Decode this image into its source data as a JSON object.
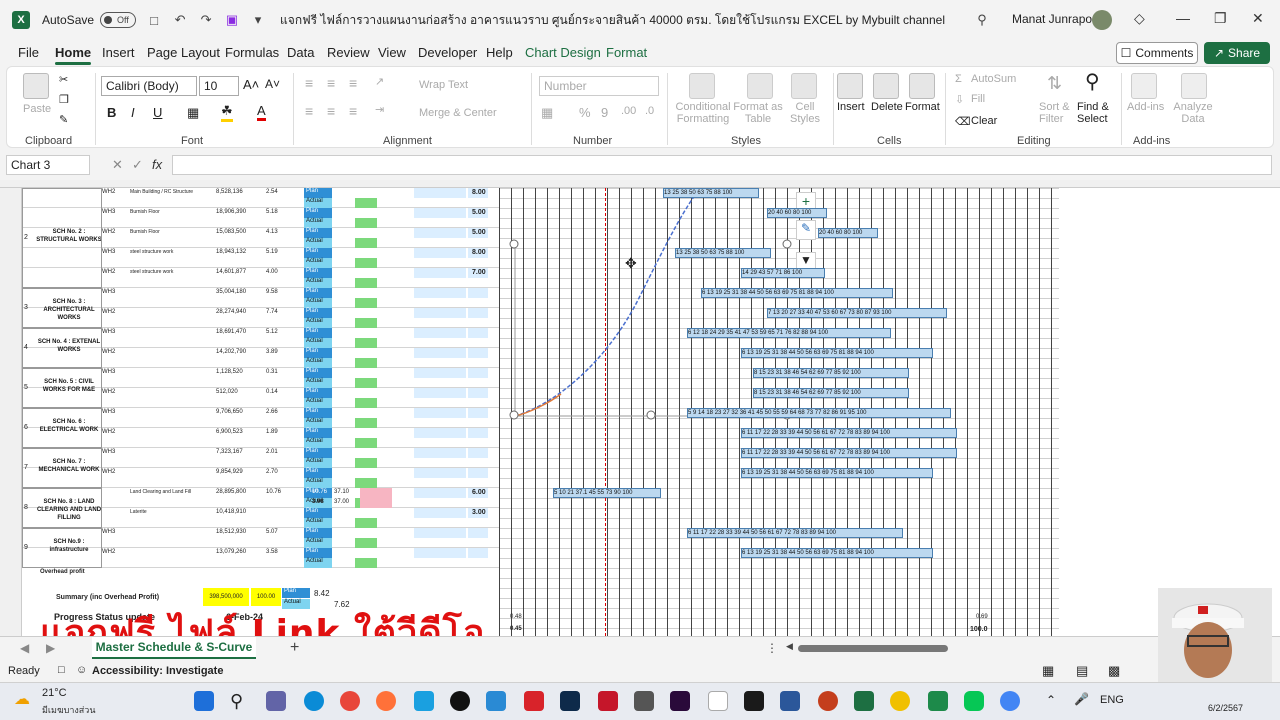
{
  "titlebar": {
    "app_icon": "X",
    "autosave_label": "AutoSave",
    "autosave_state": "Off",
    "doc_title": "แจกฟรี ไฟล์การวางแผนงานก่อสร้าง อาคารแนวราบ ศูนย์กระจายสินค้า 40000 ตรม. โดยใช้โปรแกรม EXCEL by Mybuilt channel",
    "user": "Manat Junrapoo",
    "icons": [
      "save-icon",
      "undo-icon",
      "redo-icon",
      "search-icon",
      "diamond-icon",
      "minimize-icon",
      "restore-icon",
      "close-icon"
    ]
  },
  "menu": {
    "tabs": [
      "File",
      "Home",
      "Insert",
      "Page Layout",
      "Formulas",
      "Data",
      "Review",
      "View",
      "Developer",
      "Help",
      "Chart Design",
      "Format"
    ],
    "comments": "Comments",
    "share": "Share"
  },
  "ribbon": {
    "clipboard": {
      "paste": "Paste",
      "label": "Clipboard"
    },
    "font": {
      "name": "Calibri (Body)",
      "size": "10",
      "bold": "B",
      "italic": "I",
      "underline": "U",
      "label": "Font"
    },
    "alignment": {
      "wrap": "Wrap Text",
      "merge": "Merge & Center",
      "label": "Alignment"
    },
    "number": {
      "format": "Number",
      "label": "Number"
    },
    "styles": {
      "conditional": "Conditional Formatting",
      "format_table": "Format as Table",
      "cell_styles": "Cell Styles",
      "label": "Styles"
    },
    "cells": {
      "insert": "Insert",
      "delete": "Delete",
      "format": "Format",
      "label": "Cells"
    },
    "editing": {
      "autosum": "AutoSum",
      "fill": "Fill",
      "clear": "Clear",
      "sort": "Sort & Filter",
      "find": "Find & Select",
      "label": "Editing"
    },
    "addins": {
      "addins": "Add-ins",
      "analyze": "Analyze Data",
      "label": "Add-ins"
    }
  },
  "formula_bar": {
    "name_box": "Chart 3",
    "fx": "fx",
    "content": ""
  },
  "sheet": {
    "rows": [
      {
        "no": "2",
        "sch": "SCH No. 2 : STRUCTURAL WORKS",
        "items": [
          {
            "zone": "WH2",
            "desc": "Main Building / RC Structure",
            "amount": "8,528,136",
            "pct": "2.54",
            "pv": "8.00"
          },
          {
            "zone": "WH3",
            "desc": "Burnish Floor",
            "amount": "18,906,390",
            "pct": "5.18",
            "pv": "5.00"
          },
          {
            "zone": "WH2",
            "desc": "Burnish Floor",
            "amount": "15,083,500",
            "pct": "4.13",
            "pv": "5.00"
          },
          {
            "zone": "WH3",
            "desc": "steel structure work",
            "amount": "18,943,132",
            "pct": "5.19",
            "pv": "8.00"
          },
          {
            "zone": "WH2",
            "desc": "steel structure work",
            "amount": "14,601,877",
            "pct": "4.00",
            "pv": "7.00"
          }
        ]
      },
      {
        "no": "3",
        "sch": "SCH No. 3 : ARCHITECTURAL WORKS",
        "items": [
          {
            "zone": "WH3",
            "desc": "",
            "amount": "35,004,180",
            "pct": "9.58",
            "pv": ""
          },
          {
            "zone": "WH2",
            "desc": "",
            "amount": "28,274,940",
            "pct": "7.74",
            "pv": ""
          }
        ]
      },
      {
        "no": "4",
        "sch": "SCH No. 4 : EXTENAL WORKS",
        "items": [
          {
            "zone": "WH3",
            "desc": "",
            "amount": "18,691,470",
            "pct": "5.12",
            "pv": ""
          },
          {
            "zone": "WH2",
            "desc": "",
            "amount": "14,202,790",
            "pct": "3.89",
            "pv": ""
          }
        ]
      },
      {
        "no": "5",
        "sch": "SCH No. 5 : CIVIL WORKS FOR M&E",
        "items": [
          {
            "zone": "WH3",
            "desc": "",
            "amount": "1,128,520",
            "pct": "0.31",
            "pv": ""
          },
          {
            "zone": "WH2",
            "desc": "",
            "amount": "512,020",
            "pct": "0.14",
            "pv": ""
          }
        ]
      },
      {
        "no": "6",
        "sch": "SCH No. 6 : ELECTRICAL WORK",
        "items": [
          {
            "zone": "WH3",
            "desc": "",
            "amount": "9,706,650",
            "pct": "2.66",
            "pv": ""
          },
          {
            "zone": "WH2",
            "desc": "",
            "amount": "6,900,523",
            "pct": "1.89",
            "pv": ""
          }
        ]
      },
      {
        "no": "7",
        "sch": "SCH No. 7 : MECHANICAL WORK",
        "items": [
          {
            "zone": "WH3",
            "desc": "",
            "amount": "7,323,167",
            "pct": "2.01",
            "pv": ""
          },
          {
            "zone": "WH2",
            "desc": "",
            "amount": "9,854,929",
            "pct": "2.70",
            "pv": ""
          }
        ]
      },
      {
        "no": "8",
        "sch": "SCH No. 8 : LAND CLEARING AND LAND FILLING",
        "items": [
          {
            "zone": "",
            "desc": "Land Clearing and Land Fill",
            "amount": "28,895,800",
            "pct": "10.76",
            "pv": "6.00"
          },
          {
            "zone": "",
            "desc": "Laterite",
            "amount": "10,418,910",
            "pct": "",
            "pv": "3.00"
          }
        ]
      },
      {
        "no": "9",
        "sch": "SCH No.9 : infrastructure",
        "items": [
          {
            "zone": "WH3",
            "desc": "",
            "amount": "18,512,930",
            "pct": "5.07",
            "pv": ""
          },
          {
            "zone": "WH2",
            "desc": "",
            "amount": "13,079,260",
            "pct": "3.58",
            "pv": ""
          }
        ]
      }
    ],
    "overhead": "Overhead profit",
    "summary_label": "Summary (inc Overhead Profit)",
    "summary_total": "398,500,000",
    "summary_pct": "100.00",
    "summary_plan": "8.42",
    "summary_actual": "7.62",
    "plan_label": "Plan",
    "actual_label": "Actual",
    "progress_label": "Progress Status update",
    "progress_date": "6-Feb-24",
    "row8_plan_val": "10.76",
    "row8_plan_val2": "37.10",
    "row8_actual_val": "3.98",
    "row8_actual_val2": "37.00",
    "final_pct": "100.0",
    "plan_cum": "0.48",
    "actual_cum": "0.45",
    "final_pct2": "0.69"
  },
  "gantt_bars": [
    {
      "row": "r1",
      "values": "13 25 38 50 63 75 88 100"
    },
    {
      "row": "r2",
      "values": "20 40 60 80 100"
    },
    {
      "row": "r3",
      "values": "20 40 60 80 100"
    },
    {
      "row": "r4",
      "values": "13 25 38 50 63 75 88 100"
    },
    {
      "row": "r5",
      "values": "14 29 43 57 71 86 100"
    },
    {
      "row": "r6",
      "values": "6 13 19 25 31 38 44 50 56 63 69 75 81 88 94 100"
    },
    {
      "row": "r7",
      "values": "7 13 20 27 33 40 47 53 60 67 73 80 87 93 100"
    },
    {
      "row": "r8",
      "values": "6 12 18 24 29 35 41 47 53 59 65 71 76 82 88 94 100"
    },
    {
      "row": "r9",
      "values": "6 13 19 25 31 38 44 50 56 63 69 75 81 88 94 100"
    },
    {
      "row": "r10",
      "values": "8 15 23 31 38 46 54 62 69 77 85 92 100"
    },
    {
      "row": "r11",
      "values": "8 15 23 31 38 46 54 62 69 77 85 92 100"
    },
    {
      "row": "r12",
      "values": "5 9 14 18 23 27 32 36 41 45 50 55 59 64 68 73 77 82 86 91 95 100"
    },
    {
      "row": "r13",
      "values": "6 11 17 22 28 33 39 44 50 56 61 67 72 78 83 89 94 100"
    },
    {
      "row": "r14",
      "values": "6 11 17 22 28 33 39 44 50 56 61 67 72 78 83 89 94 100"
    },
    {
      "row": "r15",
      "values": "6 13 19 25 31 38 44 50 56 63 69 75 81 88 94 100"
    },
    {
      "row": "r16",
      "values": "5 10 21 37.1 45 55 73 90 100"
    },
    {
      "row": "r17",
      "values": "6 11 17 22 28 33 39 44 50 56 61 67 72 78 83 89 94 100"
    },
    {
      "row": "r18",
      "values": "6 13 19 25 31 38 44 50 56 63 69 75 81 88 94 100"
    }
  ],
  "overlay_caption": "แจกฟรี ไฟล์ Link ใต้วีดีโอ",
  "sheet_tab": "Master Schedule & S-Curve",
  "status": {
    "ready": "Ready",
    "accessibility": "Accessibility: Investigate"
  },
  "taskbar": {
    "temp": "21°C",
    "weather": "มีเมฆบางส่วน",
    "lang": "ENG",
    "date": "6/2/2567"
  }
}
